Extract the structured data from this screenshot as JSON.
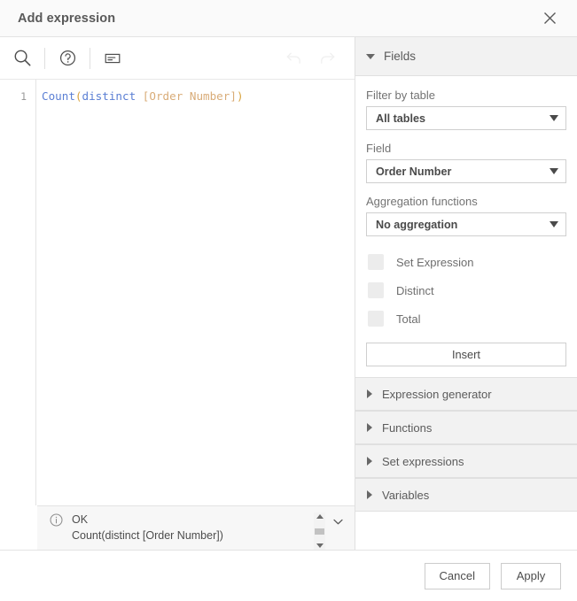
{
  "dialog": {
    "title": "Add expression",
    "close_icon": "close-icon"
  },
  "toolbar": {
    "items": [
      {
        "name": "search-icon",
        "label": "Search",
        "disabled": false
      },
      {
        "name": "help-icon",
        "label": "Help",
        "disabled": false
      },
      {
        "name": "text-format-icon",
        "label": "Format",
        "disabled": false
      },
      {
        "name": "undo-icon",
        "label": "Undo",
        "disabled": true
      },
      {
        "name": "redo-icon",
        "label": "Redo",
        "disabled": true
      }
    ]
  },
  "editor": {
    "line_number": "1",
    "tokens": {
      "fn": "Count",
      "open_paren": "(",
      "keyword": "distinct",
      "space": " ",
      "field": "[Order Number]",
      "close_paren": ")"
    },
    "full_expression": "Count(distinct [Order Number])"
  },
  "status": {
    "icon": "info-icon",
    "state": "OK",
    "preview": "Count(distinct [Order Number])",
    "scroll_up_icon": "triangle-up-icon",
    "scroll_down_icon": "triangle-down-icon",
    "collapse_icon": "chevron-down-icon"
  },
  "fields_panel": {
    "header": {
      "title": "Fields",
      "expanded": true,
      "toggle_icon": "triangle-down-icon"
    },
    "filter_by_table": {
      "label": "Filter by table",
      "value": "All tables",
      "dropdown_icon": "triangle-down-icon"
    },
    "field": {
      "label": "Field",
      "value": "Order Number",
      "dropdown_icon": "triangle-down-icon"
    },
    "aggregation": {
      "label": "Aggregation functions",
      "value": "No aggregation",
      "dropdown_icon": "triangle-down-icon"
    },
    "checkboxes": [
      {
        "label": "Set Expression",
        "checked": false
      },
      {
        "label": "Distinct",
        "checked": false
      },
      {
        "label": "Total",
        "checked": false
      }
    ],
    "insert_label": "Insert"
  },
  "accordions": [
    {
      "title": "Expression generator",
      "expanded": false,
      "toggle_icon": "triangle-right-icon"
    },
    {
      "title": "Functions",
      "expanded": false,
      "toggle_icon": "triangle-right-icon"
    },
    {
      "title": "Set expressions",
      "expanded": false,
      "toggle_icon": "triangle-right-icon"
    },
    {
      "title": "Variables",
      "expanded": false,
      "toggle_icon": "triangle-right-icon"
    }
  ],
  "footer": {
    "cancel_label": "Cancel",
    "apply_label": "Apply"
  },
  "colors": {
    "token_function": "#5b7fd4",
    "token_keyword": "#5b7fd4",
    "token_paren": "#d9a441",
    "token_field": "#d9ac78",
    "panel_header_bg": "#f2f2f2",
    "dialog_border": "#e3e3e3"
  }
}
